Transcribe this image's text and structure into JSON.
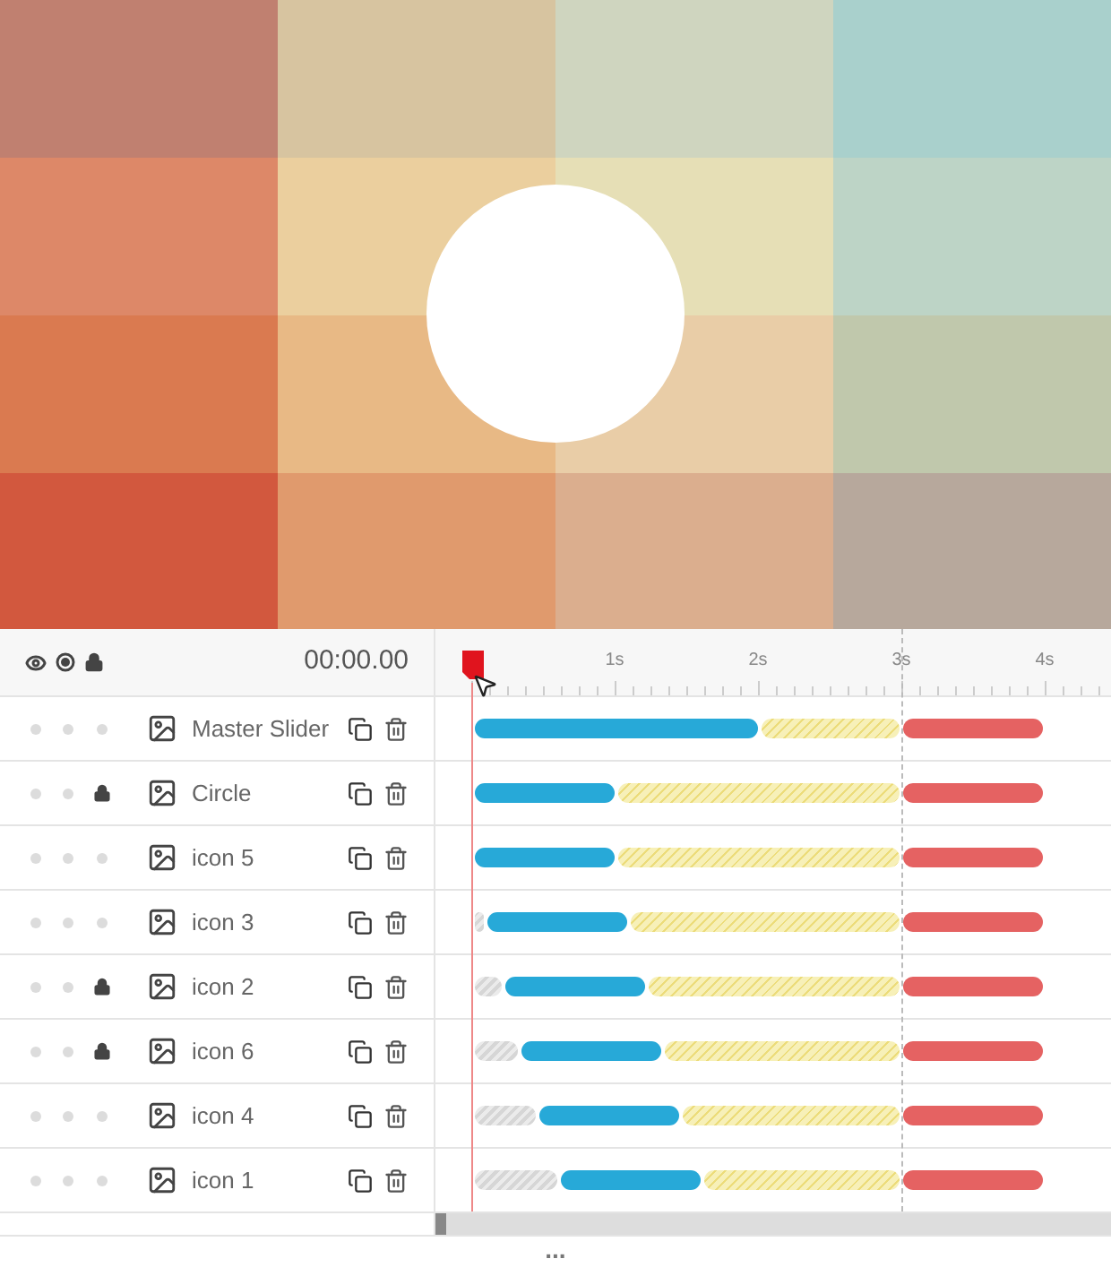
{
  "timeline": {
    "time": "00:00.00",
    "ruler_labels": [
      "1s",
      "2s",
      "3s",
      "4s"
    ],
    "layers": [
      {
        "name": "Master Slider",
        "locked": false,
        "segments": [
          {
            "kind": "in"
          },
          {
            "kind": "wait"
          },
          {
            "kind": "out"
          }
        ]
      },
      {
        "name": "Circle",
        "locked": true,
        "segments": [
          {
            "kind": "in"
          },
          {
            "kind": "wait"
          },
          {
            "kind": "out"
          }
        ]
      },
      {
        "name": "icon 5",
        "locked": false,
        "segments": [
          {
            "kind": "in"
          },
          {
            "kind": "wait"
          },
          {
            "kind": "out"
          }
        ]
      },
      {
        "name": "icon 3",
        "locked": false,
        "segments": [
          {
            "kind": "delay"
          },
          {
            "kind": "in"
          },
          {
            "kind": "wait"
          },
          {
            "kind": "out"
          }
        ]
      },
      {
        "name": "icon 2",
        "locked": true,
        "segments": [
          {
            "kind": "delay"
          },
          {
            "kind": "in"
          },
          {
            "kind": "wait"
          },
          {
            "kind": "out"
          }
        ]
      },
      {
        "name": "icon 6",
        "locked": true,
        "segments": [
          {
            "kind": "delay"
          },
          {
            "kind": "in"
          },
          {
            "kind": "wait"
          },
          {
            "kind": "out"
          }
        ]
      },
      {
        "name": "icon 4",
        "locked": false,
        "segments": [
          {
            "kind": "delay"
          },
          {
            "kind": "in"
          },
          {
            "kind": "wait"
          },
          {
            "kind": "out"
          }
        ]
      },
      {
        "name": "icon 1",
        "locked": false,
        "segments": [
          {
            "kind": "delay"
          },
          {
            "kind": "in"
          },
          {
            "kind": "wait"
          },
          {
            "kind": "out"
          }
        ]
      }
    ],
    "more": "..."
  }
}
